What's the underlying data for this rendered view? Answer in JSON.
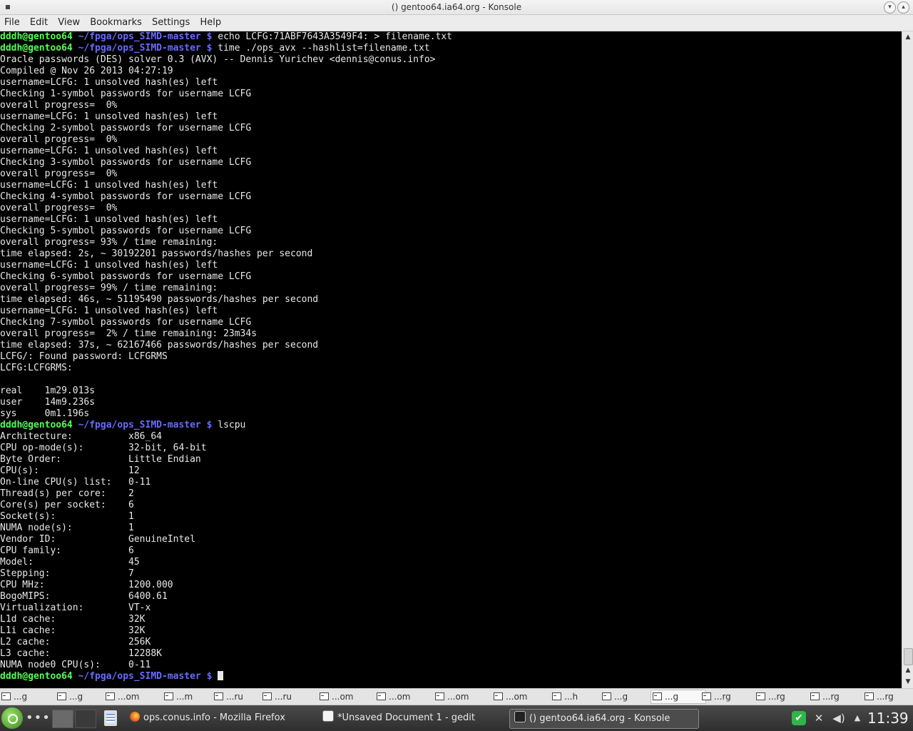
{
  "window": {
    "title": "() gentoo64.ia64.org - Konsole",
    "minimize_icon": "chevron-down-icon",
    "maximize_icon": "chevron-up-icon"
  },
  "menu": [
    "File",
    "Edit",
    "View",
    "Bookmarks",
    "Settings",
    "Help"
  ],
  "terminal": {
    "prompt_user": "dddh@gentoo64",
    "prompt_path": "~/fpga/ops_SIMD-master $",
    "lines": [
      {
        "cmd": "echo LCFG:71ABF7643A3549F4: > filename.txt"
      },
      {
        "cmd": "time ./ops_avx --hashlist=filename.txt"
      },
      {
        "text": "Oracle passwords (DES) solver 0.3 (AVX) -- Dennis Yurichev <dennis@conus.info>"
      },
      {
        "text": "Compiled @ Nov 26 2013 04:27:19"
      },
      {
        "text": "username=LCFG: 1 unsolved hash(es) left"
      },
      {
        "text": "Checking 1-symbol passwords for username LCFG"
      },
      {
        "text": "overall progress=  0%"
      },
      {
        "text": "username=LCFG: 1 unsolved hash(es) left"
      },
      {
        "text": "Checking 2-symbol passwords for username LCFG"
      },
      {
        "text": "overall progress=  0%"
      },
      {
        "text": "username=LCFG: 1 unsolved hash(es) left"
      },
      {
        "text": "Checking 3-symbol passwords for username LCFG"
      },
      {
        "text": "overall progress=  0%"
      },
      {
        "text": "username=LCFG: 1 unsolved hash(es) left"
      },
      {
        "text": "Checking 4-symbol passwords for username LCFG"
      },
      {
        "text": "overall progress=  0%"
      },
      {
        "text": "username=LCFG: 1 unsolved hash(es) left"
      },
      {
        "text": "Checking 5-symbol passwords for username LCFG"
      },
      {
        "text": "overall progress= 93% / time remaining:"
      },
      {
        "text": "time elapsed: 2s, ~ 30192201 passwords/hashes per second"
      },
      {
        "text": "username=LCFG: 1 unsolved hash(es) left"
      },
      {
        "text": "Checking 6-symbol passwords for username LCFG"
      },
      {
        "text": "overall progress= 99% / time remaining:"
      },
      {
        "text": "time elapsed: 46s, ~ 51195490 passwords/hashes per second"
      },
      {
        "text": "username=LCFG: 1 unsolved hash(es) left"
      },
      {
        "text": "Checking 7-symbol passwords for username LCFG"
      },
      {
        "text": "overall progress=  2% / time remaining: 23m34s"
      },
      {
        "text": "time elapsed: 37s, ~ 62167466 passwords/hashes per second"
      },
      {
        "text": "LCFG/: Found password: LCFGRMS"
      },
      {
        "text": "LCFG:LCFGRMS:"
      },
      {
        "text": ""
      },
      {
        "text": "real    1m29.013s"
      },
      {
        "text": "user    14m9.236s"
      },
      {
        "text": "sys     0m1.196s"
      },
      {
        "cmd": "lscpu"
      },
      {
        "text": "Architecture:          x86_64"
      },
      {
        "text": "CPU op-mode(s):        32-bit, 64-bit"
      },
      {
        "text": "Byte Order:            Little Endian"
      },
      {
        "text": "CPU(s):                12"
      },
      {
        "text": "On-line CPU(s) list:   0-11"
      },
      {
        "text": "Thread(s) per core:    2"
      },
      {
        "text": "Core(s) per socket:    6"
      },
      {
        "text": "Socket(s):             1"
      },
      {
        "text": "NUMA node(s):          1"
      },
      {
        "text": "Vendor ID:             GenuineIntel"
      },
      {
        "text": "CPU family:            6"
      },
      {
        "text": "Model:                 45"
      },
      {
        "text": "Stepping:              7"
      },
      {
        "text": "CPU MHz:               1200.000"
      },
      {
        "text": "BogoMIPS:              6400.61"
      },
      {
        "text": "Virtualization:        VT-x"
      },
      {
        "text": "L1d cache:             32K"
      },
      {
        "text": "L1i cache:             32K"
      },
      {
        "text": "L2 cache:              256K"
      },
      {
        "text": "L3 cache:              12288K"
      },
      {
        "text": "NUMA node0 CPU(s):     0-11"
      },
      {
        "cmd": "",
        "cursor": true
      }
    ]
  },
  "session_tabs": [
    {
      "label": "...g"
    },
    {
      "label": "...g"
    },
    {
      "label": "...om"
    },
    {
      "label": "...m"
    },
    {
      "label": "...ru"
    },
    {
      "label": "...ru"
    },
    {
      "label": "...om"
    },
    {
      "label": "...om"
    },
    {
      "label": "...om"
    },
    {
      "label": "...om"
    },
    {
      "label": "...h"
    },
    {
      "label": "...g"
    },
    {
      "label": "...g",
      "active": true
    },
    {
      "label": "...rg"
    },
    {
      "label": "...rg"
    },
    {
      "label": "...rg"
    },
    {
      "label": "...rg"
    }
  ],
  "taskbar": {
    "tasks": [
      {
        "label": "ops.conus.info - Mozilla Firefox",
        "icon": "firefox-icon"
      },
      {
        "label": "*Unsaved Document 1 - gedit",
        "icon": "gedit-icon"
      },
      {
        "label": "() gentoo64.ia64.org - Konsole",
        "icon": "konsole-icon",
        "active": true
      }
    ],
    "clock": "11:39"
  },
  "colors": {
    "prompt_user": "#54ff54",
    "prompt_path": "#6a6aff",
    "terminal_bg": "#000000",
    "terminal_fg": "#e8e8e8"
  }
}
